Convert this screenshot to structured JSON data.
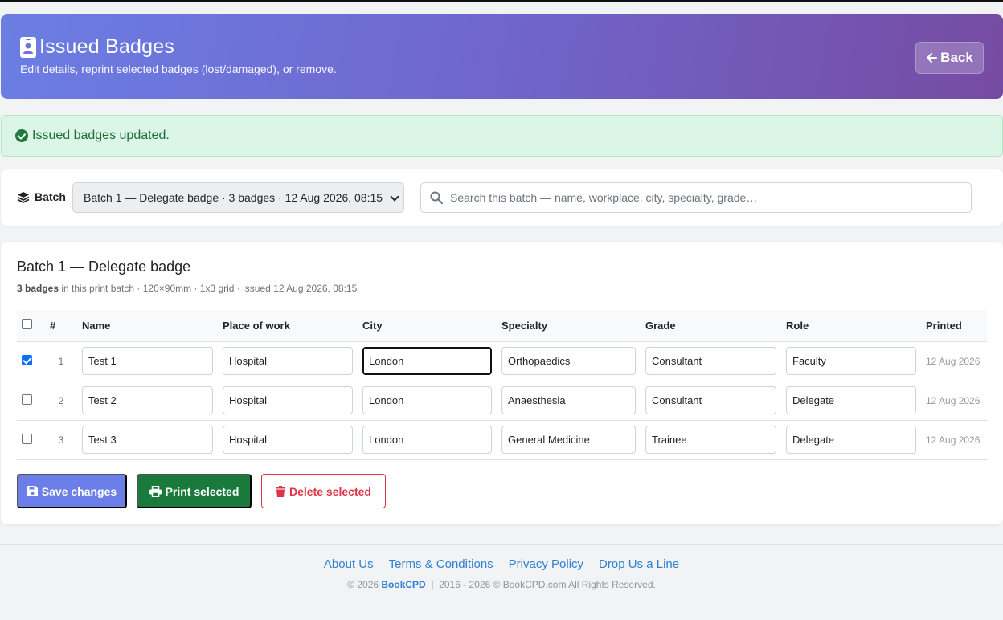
{
  "header": {
    "title": "Issued Badges",
    "subtitle": "Edit details, reprint selected badges (lost/damaged), or remove.",
    "back_label": "Back"
  },
  "alert": {
    "message": "Issued badges updated."
  },
  "filter": {
    "batch_label": "Batch",
    "batch_selected": "Batch 1 — Delegate badge · 3 badges · 12 Aug 2026, 08:15",
    "search_placeholder": "Search this batch — name, workplace, city, specialty, grade…"
  },
  "batch": {
    "title": "Batch 1 — Delegate badge",
    "count_label": "3 badges",
    "meta_rest": " in this print batch · 120×90mm · 1x3 grid · issued 12 Aug 2026, 08:15"
  },
  "table": {
    "columns": {
      "num": "#",
      "name": "Name",
      "workplace": "Place of work",
      "city": "City",
      "specialty": "Specialty",
      "grade": "Grade",
      "role": "Role",
      "printed": "Printed"
    },
    "rows": [
      {
        "selected": true,
        "num": "1",
        "name": "Test 1",
        "workplace": "Hospital",
        "city": "London",
        "specialty": "Orthopaedics",
        "grade": "Consultant",
        "role": "Faculty",
        "printed": "12 Aug 2026"
      },
      {
        "selected": false,
        "num": "2",
        "name": "Test 2",
        "workplace": "Hospital",
        "city": "London",
        "specialty": "Anaesthesia",
        "grade": "Consultant",
        "role": "Delegate",
        "printed": "12 Aug 2026"
      },
      {
        "selected": false,
        "num": "3",
        "name": "Test 3",
        "workplace": "Hospital",
        "city": "London",
        "specialty": "General Medicine",
        "grade": "Trainee",
        "role": "Delegate",
        "printed": "12 Aug 2026"
      }
    ]
  },
  "actions": {
    "save": "Save changes",
    "print": "Print selected",
    "delete": "Delete selected"
  },
  "footer": {
    "links": {
      "about": "About Us",
      "terms": "Terms & Conditions",
      "privacy": "Privacy Policy",
      "contact": "Drop Us a Line"
    },
    "copyright_prefix": "© 2026 ",
    "brand": "BookCPD",
    "copyright_suffix": "  |  2016 - 2026 © BookCPD.com All Rights Reserved."
  },
  "colors": {
    "header_gradient_start": "#6b7ee3",
    "header_gradient_end": "#764ba2",
    "success": "#1a7a3c",
    "danger": "#dc3545",
    "primary": "#6c7ee8",
    "link": "#2f80d1"
  }
}
